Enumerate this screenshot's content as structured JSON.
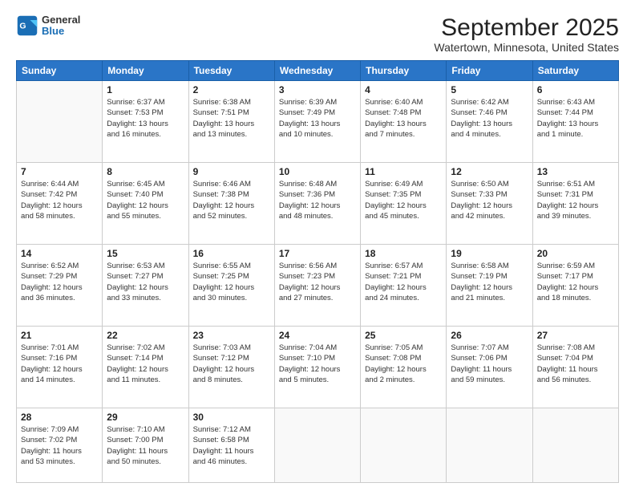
{
  "header": {
    "logo_general": "General",
    "logo_blue": "Blue",
    "month_title": "September 2025",
    "location": "Watertown, Minnesota, United States"
  },
  "days_of_week": [
    "Sunday",
    "Monday",
    "Tuesday",
    "Wednesday",
    "Thursday",
    "Friday",
    "Saturday"
  ],
  "weeks": [
    [
      {
        "day": "",
        "info": ""
      },
      {
        "day": "1",
        "info": "Sunrise: 6:37 AM\nSunset: 7:53 PM\nDaylight: 13 hours\nand 16 minutes."
      },
      {
        "day": "2",
        "info": "Sunrise: 6:38 AM\nSunset: 7:51 PM\nDaylight: 13 hours\nand 13 minutes."
      },
      {
        "day": "3",
        "info": "Sunrise: 6:39 AM\nSunset: 7:49 PM\nDaylight: 13 hours\nand 10 minutes."
      },
      {
        "day": "4",
        "info": "Sunrise: 6:40 AM\nSunset: 7:48 PM\nDaylight: 13 hours\nand 7 minutes."
      },
      {
        "day": "5",
        "info": "Sunrise: 6:42 AM\nSunset: 7:46 PM\nDaylight: 13 hours\nand 4 minutes."
      },
      {
        "day": "6",
        "info": "Sunrise: 6:43 AM\nSunset: 7:44 PM\nDaylight: 13 hours\nand 1 minute."
      }
    ],
    [
      {
        "day": "7",
        "info": "Sunrise: 6:44 AM\nSunset: 7:42 PM\nDaylight: 12 hours\nand 58 minutes."
      },
      {
        "day": "8",
        "info": "Sunrise: 6:45 AM\nSunset: 7:40 PM\nDaylight: 12 hours\nand 55 minutes."
      },
      {
        "day": "9",
        "info": "Sunrise: 6:46 AM\nSunset: 7:38 PM\nDaylight: 12 hours\nand 52 minutes."
      },
      {
        "day": "10",
        "info": "Sunrise: 6:48 AM\nSunset: 7:36 PM\nDaylight: 12 hours\nand 48 minutes."
      },
      {
        "day": "11",
        "info": "Sunrise: 6:49 AM\nSunset: 7:35 PM\nDaylight: 12 hours\nand 45 minutes."
      },
      {
        "day": "12",
        "info": "Sunrise: 6:50 AM\nSunset: 7:33 PM\nDaylight: 12 hours\nand 42 minutes."
      },
      {
        "day": "13",
        "info": "Sunrise: 6:51 AM\nSunset: 7:31 PM\nDaylight: 12 hours\nand 39 minutes."
      }
    ],
    [
      {
        "day": "14",
        "info": "Sunrise: 6:52 AM\nSunset: 7:29 PM\nDaylight: 12 hours\nand 36 minutes."
      },
      {
        "day": "15",
        "info": "Sunrise: 6:53 AM\nSunset: 7:27 PM\nDaylight: 12 hours\nand 33 minutes."
      },
      {
        "day": "16",
        "info": "Sunrise: 6:55 AM\nSunset: 7:25 PM\nDaylight: 12 hours\nand 30 minutes."
      },
      {
        "day": "17",
        "info": "Sunrise: 6:56 AM\nSunset: 7:23 PM\nDaylight: 12 hours\nand 27 minutes."
      },
      {
        "day": "18",
        "info": "Sunrise: 6:57 AM\nSunset: 7:21 PM\nDaylight: 12 hours\nand 24 minutes."
      },
      {
        "day": "19",
        "info": "Sunrise: 6:58 AM\nSunset: 7:19 PM\nDaylight: 12 hours\nand 21 minutes."
      },
      {
        "day": "20",
        "info": "Sunrise: 6:59 AM\nSunset: 7:17 PM\nDaylight: 12 hours\nand 18 minutes."
      }
    ],
    [
      {
        "day": "21",
        "info": "Sunrise: 7:01 AM\nSunset: 7:16 PM\nDaylight: 12 hours\nand 14 minutes."
      },
      {
        "day": "22",
        "info": "Sunrise: 7:02 AM\nSunset: 7:14 PM\nDaylight: 12 hours\nand 11 minutes."
      },
      {
        "day": "23",
        "info": "Sunrise: 7:03 AM\nSunset: 7:12 PM\nDaylight: 12 hours\nand 8 minutes."
      },
      {
        "day": "24",
        "info": "Sunrise: 7:04 AM\nSunset: 7:10 PM\nDaylight: 12 hours\nand 5 minutes."
      },
      {
        "day": "25",
        "info": "Sunrise: 7:05 AM\nSunset: 7:08 PM\nDaylight: 12 hours\nand 2 minutes."
      },
      {
        "day": "26",
        "info": "Sunrise: 7:07 AM\nSunset: 7:06 PM\nDaylight: 11 hours\nand 59 minutes."
      },
      {
        "day": "27",
        "info": "Sunrise: 7:08 AM\nSunset: 7:04 PM\nDaylight: 11 hours\nand 56 minutes."
      }
    ],
    [
      {
        "day": "28",
        "info": "Sunrise: 7:09 AM\nSunset: 7:02 PM\nDaylight: 11 hours\nand 53 minutes."
      },
      {
        "day": "29",
        "info": "Sunrise: 7:10 AM\nSunset: 7:00 PM\nDaylight: 11 hours\nand 50 minutes."
      },
      {
        "day": "30",
        "info": "Sunrise: 7:12 AM\nSunset: 6:58 PM\nDaylight: 11 hours\nand 46 minutes."
      },
      {
        "day": "",
        "info": ""
      },
      {
        "day": "",
        "info": ""
      },
      {
        "day": "",
        "info": ""
      },
      {
        "day": "",
        "info": ""
      }
    ]
  ]
}
